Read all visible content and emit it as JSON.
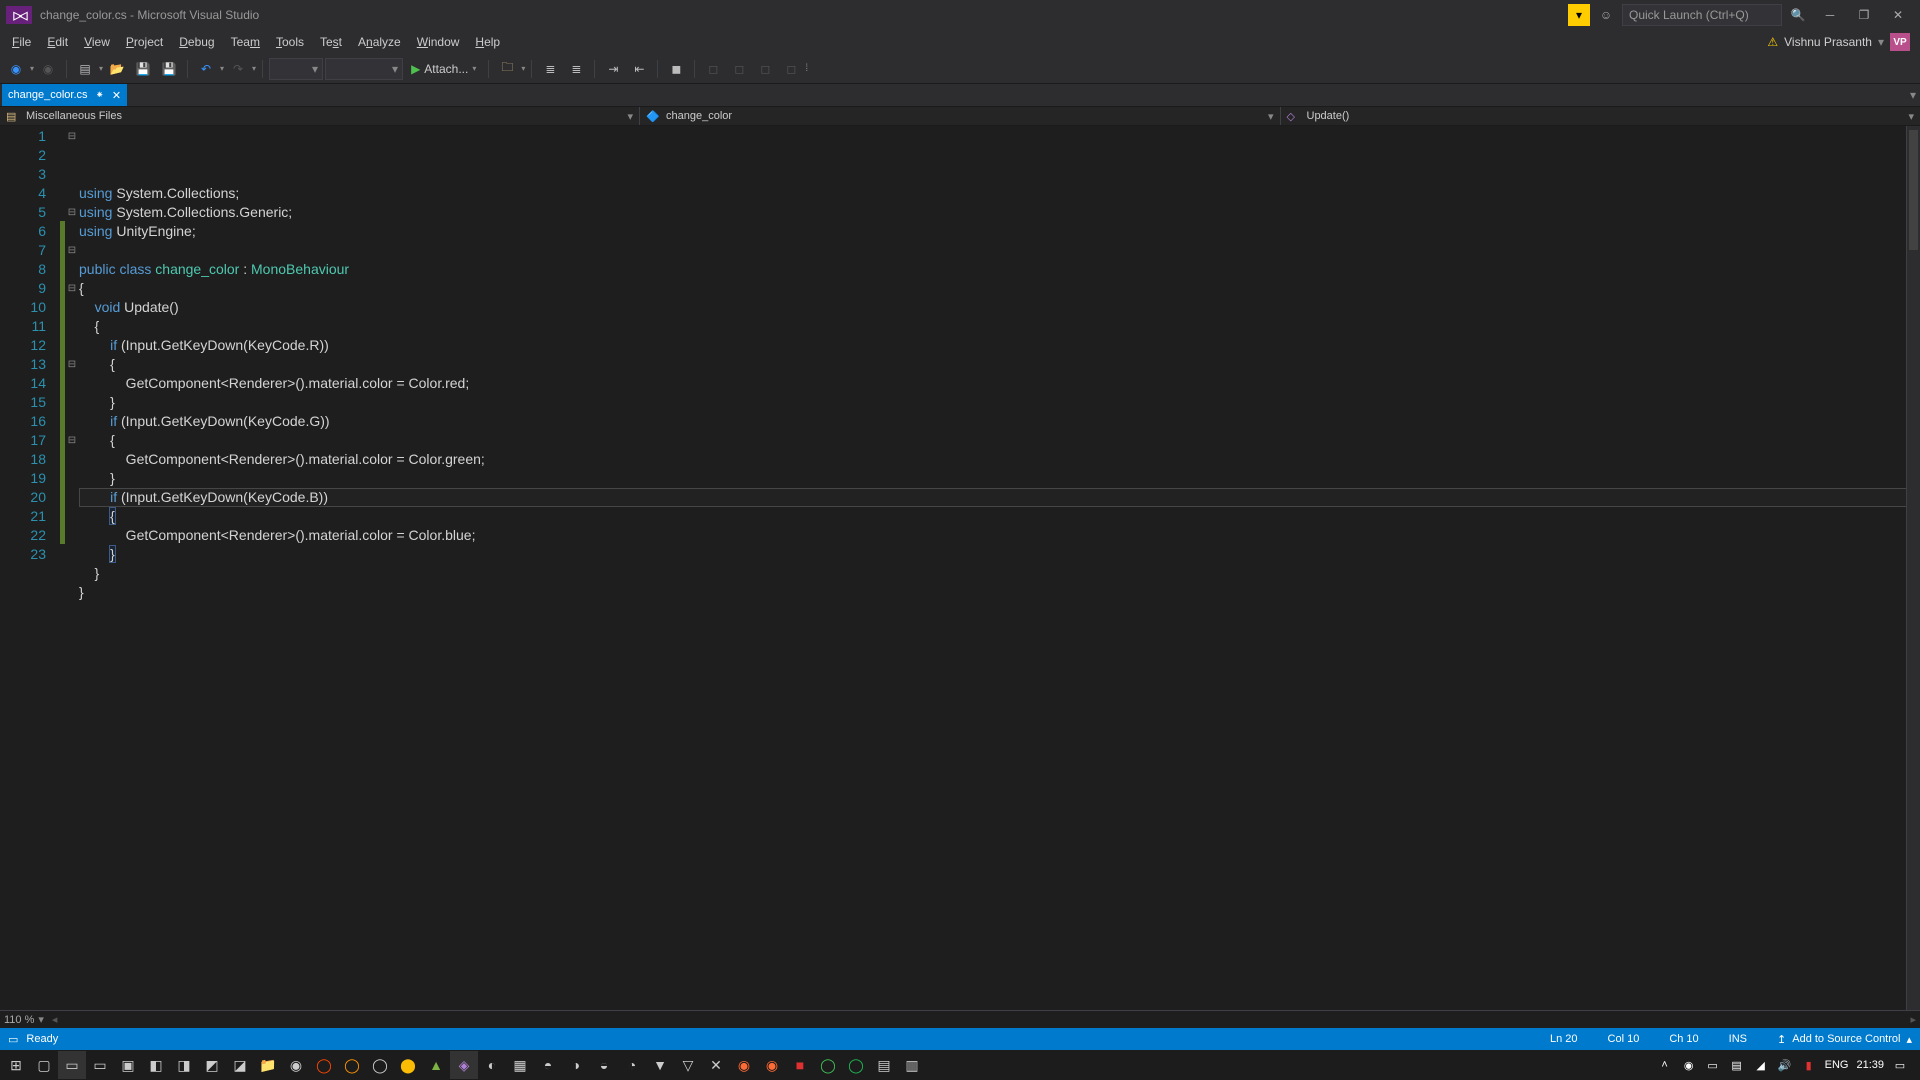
{
  "title": "change_color.cs - Microsoft Visual Studio",
  "quick_launch_placeholder": "Quick Launch (Ctrl+Q)",
  "user_name": "Vishnu Prasanth",
  "user_initials": "VP",
  "menu": [
    "File",
    "Edit",
    "View",
    "Project",
    "Debug",
    "Team",
    "Tools",
    "Test",
    "Analyze",
    "Window",
    "Help"
  ],
  "attach_label": "Attach...",
  "tab": {
    "name": "change_color.cs",
    "dirty": "⁕"
  },
  "nav": {
    "scope": "Miscellaneous Files",
    "class": "change_color",
    "member": "Update()"
  },
  "zoom": "110 %",
  "status": {
    "state": "Ready",
    "ln": "Ln 20",
    "col": "Col 10",
    "ch": "Ch 10",
    "ins": "INS",
    "scc": "Add to Source Control"
  },
  "tray": {
    "lang": "ENG",
    "time": "21:39"
  },
  "code_lines": [
    {
      "n": 1,
      "fold": "⊟",
      "html": "<span class='tok-kw'>using</span> System.Collections;"
    },
    {
      "n": 2,
      "fold": "",
      "html": "<span class='tok-kw'>using</span> System.Collections.Generic;"
    },
    {
      "n": 3,
      "fold": "",
      "html": "<span class='tok-kw'>using</span> UnityEngine;"
    },
    {
      "n": 4,
      "fold": "",
      "html": ""
    },
    {
      "n": 5,
      "fold": "⊟",
      "html": "<span class='tok-kw'>public</span> <span class='tok-kw'>class</span> <span class='tok-cls'>change_color</span> : <span class='tok-cls'>MonoBehaviour</span>"
    },
    {
      "n": 6,
      "fold": "",
      "cb": "y",
      "html": "{"
    },
    {
      "n": 7,
      "fold": "⊟",
      "cb": "y",
      "html": "    <span class='tok-kw'>void</span> Update()"
    },
    {
      "n": 8,
      "fold": "",
      "cb": "y",
      "html": "    {"
    },
    {
      "n": 9,
      "fold": "⊟",
      "cb": "y",
      "html": "        <span class='tok-kw'>if</span> (Input.GetKeyDown(KeyCode.R))"
    },
    {
      "n": 10,
      "fold": "",
      "cb": "y",
      "html": "        {"
    },
    {
      "n": 11,
      "fold": "",
      "cb": "y",
      "html": "            GetComponent&lt;Renderer&gt;().material.color = Color.red;"
    },
    {
      "n": 12,
      "fold": "",
      "cb": "y",
      "html": "        }"
    },
    {
      "n": 13,
      "fold": "⊟",
      "cb": "y",
      "html": "        <span class='tok-kw'>if</span> (Input.GetKeyDown(KeyCode.G))"
    },
    {
      "n": 14,
      "fold": "",
      "cb": "y",
      "html": "        {"
    },
    {
      "n": 15,
      "fold": "",
      "cb": "y",
      "html": "            GetComponent&lt;Renderer&gt;().material.color = Color.green;"
    },
    {
      "n": 16,
      "fold": "",
      "cb": "y",
      "html": "        }"
    },
    {
      "n": 17,
      "fold": "⊟",
      "cb": "y",
      "html": "        <span class='tok-kw'>if</span> (Input.GetKeyDown(KeyCode.B))"
    },
    {
      "n": 18,
      "fold": "",
      "cb": "y",
      "html": "        <span class='hl-brace'>{</span>"
    },
    {
      "n": 19,
      "fold": "",
      "cb": "y",
      "html": "            GetComponent&lt;Renderer&gt;().material.color = Color.blue;"
    },
    {
      "n": 20,
      "fold": "",
      "cb": "y",
      "html": "        <span class='hl-brace'>}</span>"
    },
    {
      "n": 21,
      "fold": "",
      "cb": "y",
      "html": "    }"
    },
    {
      "n": 22,
      "fold": "",
      "cb": "y",
      "html": "}"
    },
    {
      "n": 23,
      "fold": "",
      "html": ""
    }
  ]
}
